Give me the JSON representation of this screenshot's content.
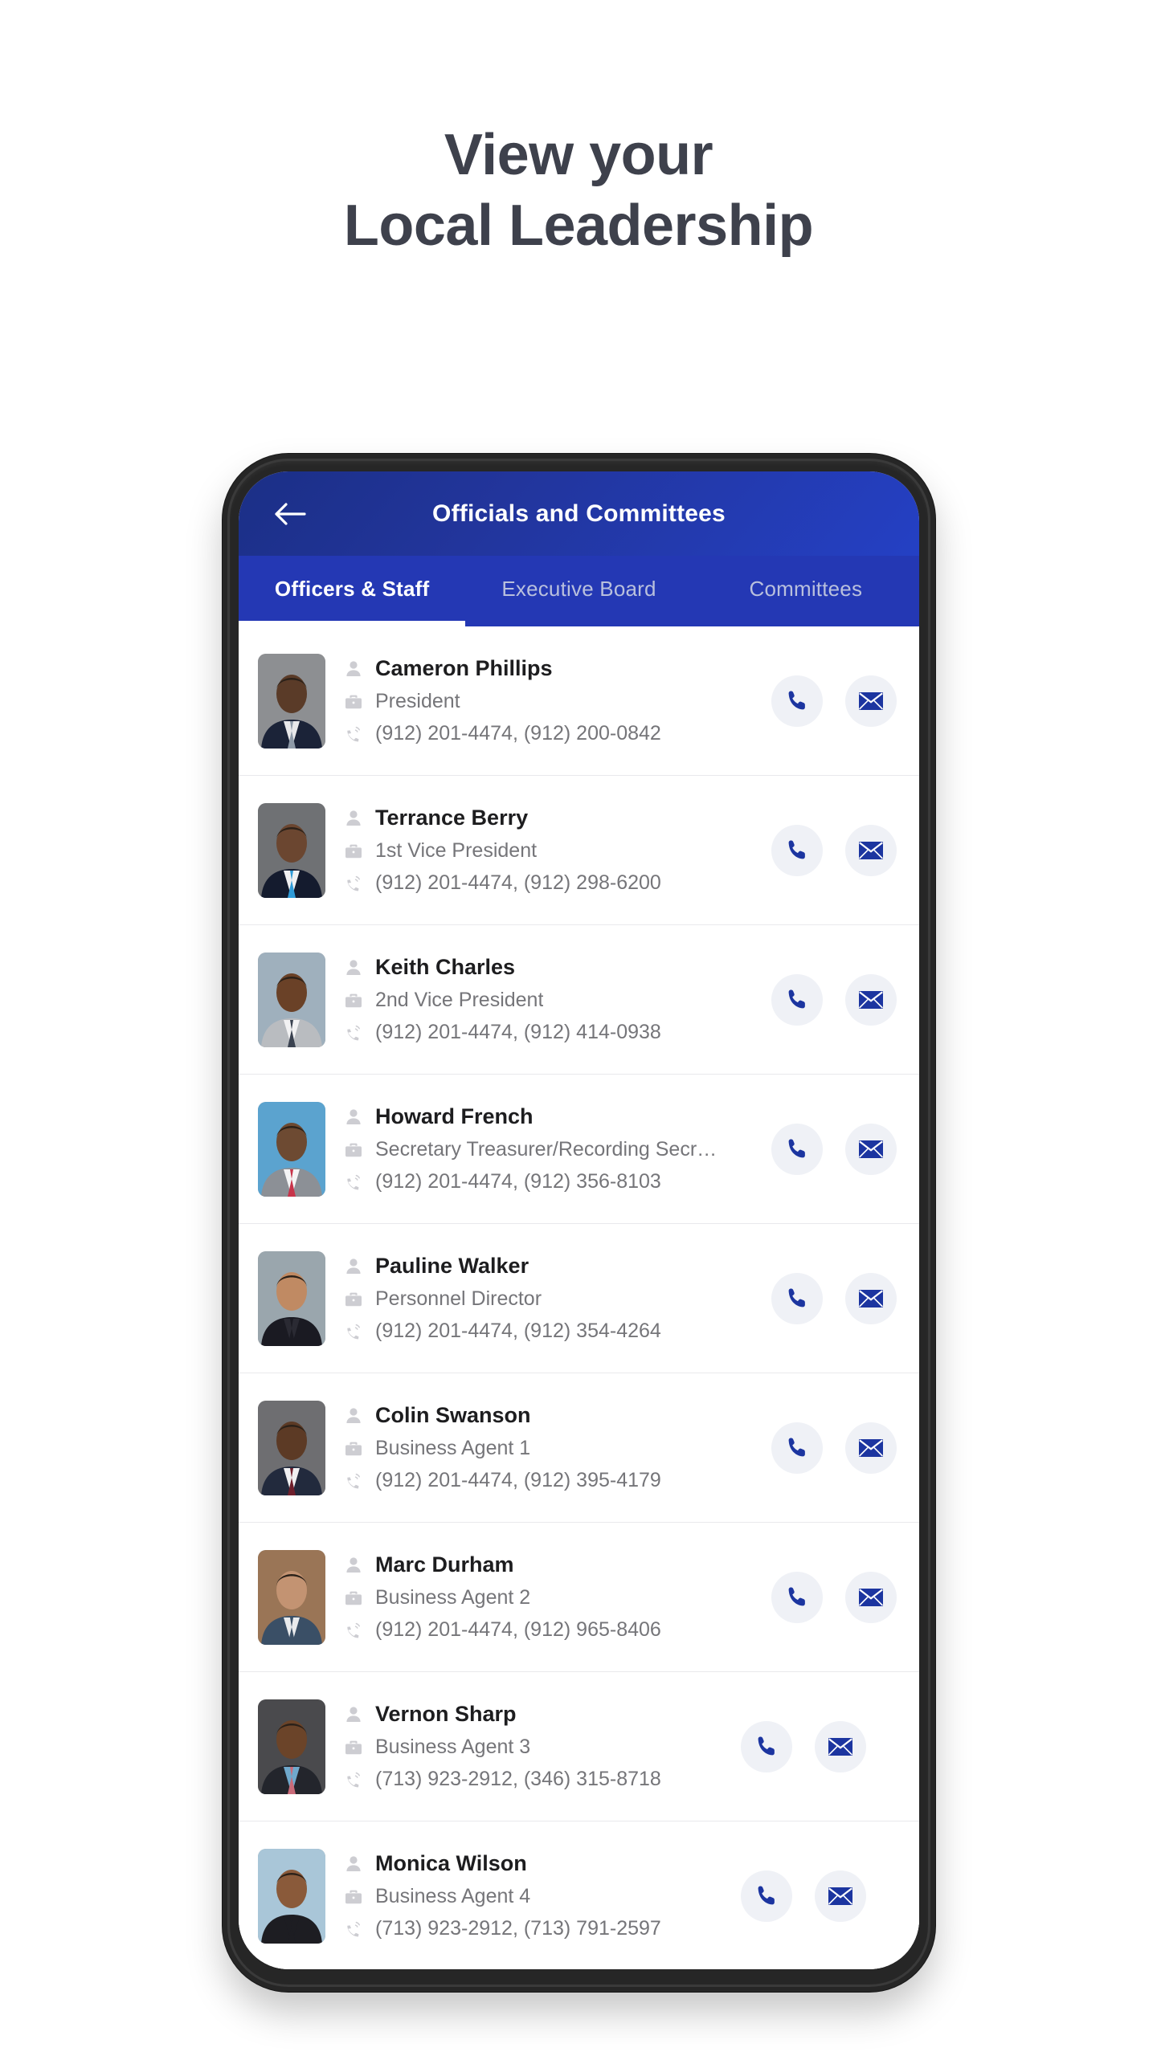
{
  "headline": {
    "line1": "View your",
    "line2": "Local Leadership"
  },
  "app": {
    "back_icon": "arrow-left-icon",
    "title": "Officials and Committees",
    "tabs": [
      {
        "label": "Officers & Staff",
        "active": true
      },
      {
        "label": "Executive Board",
        "active": false
      },
      {
        "label": "Committees",
        "active": false
      }
    ],
    "row_icons": {
      "name": "person-icon",
      "title": "briefcase-icon",
      "phone": "ringing-phone-icon"
    },
    "actions": {
      "call_label": "phone-icon",
      "email_label": "envelope-icon"
    },
    "people": [
      {
        "name": "Cameron Phillips",
        "title": "President",
        "phones": "(912) 201-4474, (912) 200-0842",
        "photo": {
          "bg": "#8d8f92",
          "skin": "#5a3b28",
          "suit": "#1b2338",
          "shirt": "#e8e8ea",
          "tie": "#8e9aa8"
        },
        "shifted": false
      },
      {
        "name": "Terrance Berry",
        "title": "1st Vice President",
        "phones": "(912) 201-4474, (912) 298-6200",
        "photo": {
          "bg": "#6f7174",
          "skin": "#6b4630",
          "suit": "#141b2e",
          "shirt": "#f0f0f2",
          "tie": "#2f9bd8"
        },
        "shifted": false
      },
      {
        "name": "Keith Charles",
        "title": "2nd Vice President",
        "phones": "(912) 201-4474, (912) 414-0938",
        "photo": {
          "bg": "#9fb0bd",
          "skin": "#6a4127",
          "suit": "#b9bcc0",
          "shirt": "#f2f2f3",
          "tie": "#3a4250"
        },
        "shifted": false
      },
      {
        "name": "Howard French",
        "title": "Secretary Treasurer/Recording Secre…",
        "phones": "(912) 201-4474, (912) 356-8103",
        "photo": {
          "bg": "#5ba3cf",
          "skin": "#6d4a32",
          "suit": "#8c9096",
          "shirt": "#f4f4f5",
          "tie": "#c7344a"
        },
        "shifted": false
      },
      {
        "name": "Pauline Walker",
        "title": "Personnel Director",
        "phones": "(912) 201-4474, (912) 354-4264",
        "photo": {
          "bg": "#9aa6ad",
          "skin": "#c08a63",
          "suit": "#1a1a22",
          "shirt": "#2a2a33",
          "tie": "#1a1a22"
        },
        "shifted": false
      },
      {
        "name": "Colin Swanson",
        "title": "Business Agent 1",
        "phones": "(912) 201-4474, (912) 395-4179",
        "photo": {
          "bg": "#6e6e71",
          "skin": "#5c3a25",
          "suit": "#222a3d",
          "shirt": "#f0f0f2",
          "tie": "#6e1f2c"
        },
        "shifted": false
      },
      {
        "name": "Marc Durham",
        "title": "Business Agent 2",
        "phones": "(912) 201-4474, (912) 965-8406",
        "photo": {
          "bg": "#9a7556",
          "skin": "#c39372",
          "suit": "#3a4f66",
          "shirt": "#e8eaec",
          "tie": "#3a4f66"
        },
        "shifted": false
      },
      {
        "name": "Vernon Sharp",
        "title": "Business Agent 3",
        "phones": "(713) 923-2912, (346) 315-8718",
        "photo": {
          "bg": "#4a4a4d",
          "skin": "#6b4429",
          "suit": "#23252c",
          "shirt": "#6fa8cc",
          "tie": "#c96a78"
        },
        "shifted": true
      },
      {
        "name": "Monica Wilson",
        "title": "Business Agent 4",
        "phones": "(713) 923-2912, (713) 791-2597",
        "photo": {
          "bg": "#a9c6d8",
          "skin": "#8a5a3a",
          "suit": "#1d1d22",
          "shirt": "#1d1d22",
          "tie": "#1d1d22"
        },
        "shifted": true
      }
    ]
  },
  "colors": {
    "headline_text": "#3e414c",
    "appbar_blue": "#22359c",
    "tabbar_blue": "#2438b4",
    "accent_icon": "#1c35a0",
    "action_bg": "#eff1f6",
    "body_text": "#1d1d1f",
    "muted_text": "#757579"
  }
}
